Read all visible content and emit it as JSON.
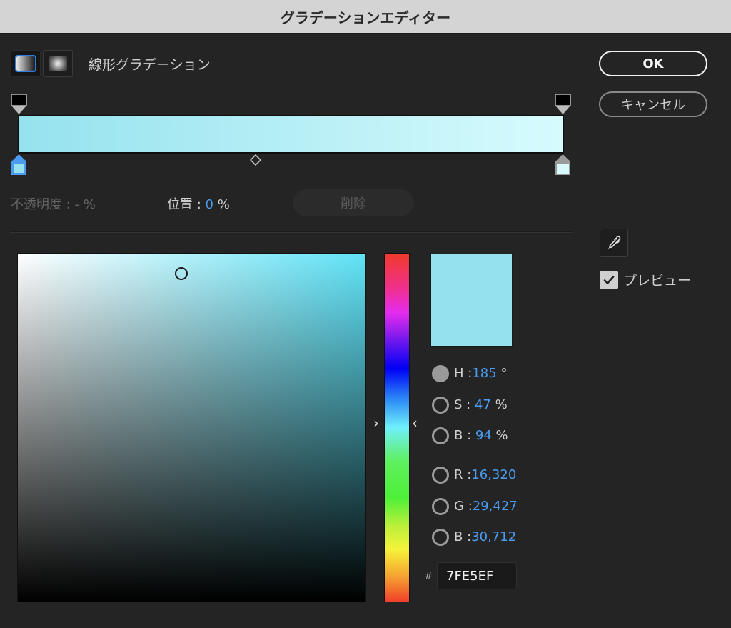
{
  "window": {
    "title": "グラデーションエディター"
  },
  "gradient_type": {
    "selected": "linear",
    "label": "線形グラデーション",
    "options": [
      {
        "id": "linear",
        "icon": "linear-gradient-icon"
      },
      {
        "id": "radial",
        "icon": "radial-gradient-icon"
      }
    ]
  },
  "buttons": {
    "ok": "OK",
    "cancel": "キャンセル",
    "delete": "削除"
  },
  "gradient": {
    "start_color": "#95e2ee",
    "end_color": "#d7fbfd",
    "opacity_stops": [
      {
        "position": 0,
        "color": "#000000"
      },
      {
        "position": 100,
        "color": "#000000"
      }
    ],
    "color_stops": [
      {
        "position": 0,
        "color": "#95e2ee",
        "selected": true
      },
      {
        "position": 100,
        "color": "#d7fbfd",
        "selected": false
      }
    ],
    "midpoint": 50
  },
  "stop_info": {
    "opacity_label": "不透明度 :",
    "opacity_value": "-",
    "opacity_unit": "%",
    "position_label": "位置 :",
    "position_value": "0",
    "position_unit": "%"
  },
  "picker": {
    "field_hue_color": "#5fe3f7",
    "cursor": {
      "saturation": 0.47,
      "brightness": 0.94
    },
    "preview_color": "#95e2ee",
    "mode": "H",
    "fields": {
      "h": {
        "label": "H",
        "sep": ":",
        "value": "185",
        "unit": "°"
      },
      "s": {
        "label": "S",
        "sep": ":",
        "value": "47",
        "unit": "%"
      },
      "b": {
        "label": "B",
        "sep": ":",
        "value": "94",
        "unit": "%"
      },
      "r": {
        "label": "R",
        "sep": ":",
        "value": "16,320"
      },
      "g": {
        "label": "G",
        "sep": ":",
        "value": "29,427"
      },
      "b2": {
        "label": "B",
        "sep": ":",
        "value": "30,712"
      }
    },
    "hash": "#",
    "hex": "7FE5EF"
  },
  "side": {
    "eyedropper_icon": "eyedropper-icon",
    "preview_checked": true,
    "preview_label": "プレビュー"
  }
}
